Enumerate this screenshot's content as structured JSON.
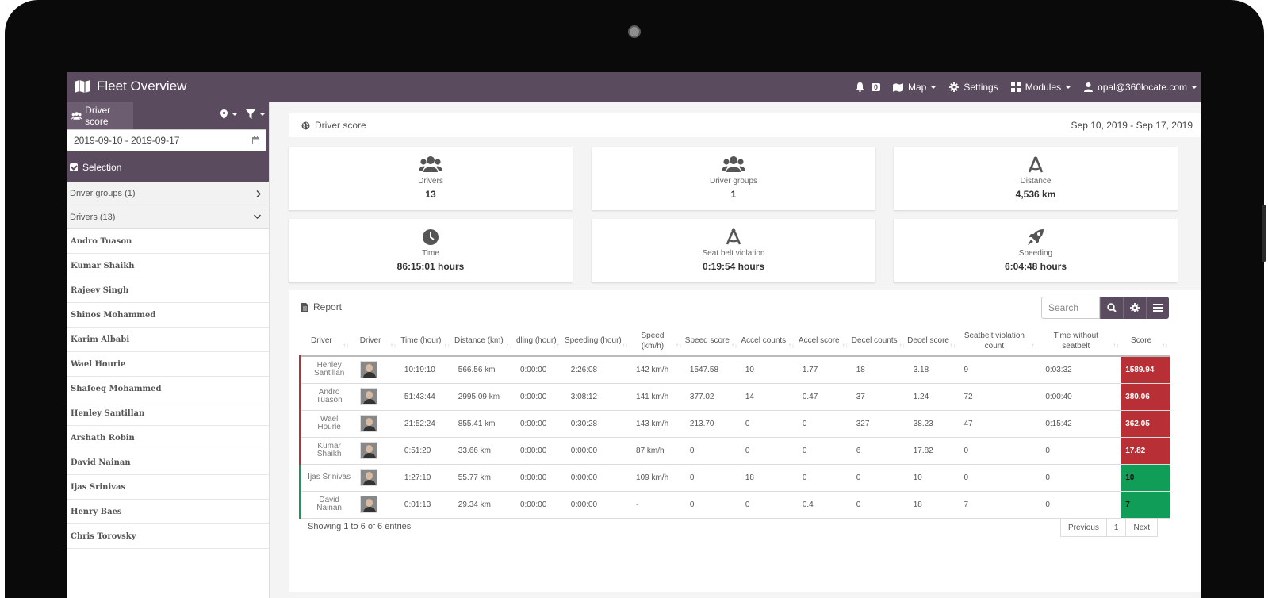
{
  "app": {
    "title": "Fleet Overview"
  },
  "nav": {
    "notifications": "0",
    "map": "Map",
    "settings": "Settings",
    "modules": "Modules",
    "user": "opal@360locate.com"
  },
  "sidebar": {
    "tab": "Driver score",
    "date_range": "2019-09-10 - 2019-09-17",
    "selection": "Selection",
    "groups": "Driver groups (1)",
    "drivers_header": "Drivers (13)",
    "drivers": [
      "Andro Tuason",
      "Kumar Shaikh",
      "Rajeev Singh",
      "Shinos Mohammed",
      "Karim Albabi",
      "Wael Hourie",
      "Shafeeq Mohammed",
      "Henley Santillan",
      "Arshath Robin",
      "David Nainan",
      "Ijas Srinivas",
      "Henry Baes",
      "Chris Torovsky"
    ]
  },
  "header": {
    "title": "Driver score",
    "range": "Sep 10, 2019 - Sep 17, 2019"
  },
  "cards": [
    {
      "label": "Drivers",
      "value": "13",
      "icon": "users-icon"
    },
    {
      "label": "Driver groups",
      "value": "1",
      "icon": "users-icon"
    },
    {
      "label": "Distance",
      "value": "4,536 km",
      "icon": "compass-icon"
    },
    {
      "label": "Time",
      "value": "86:15:01 hours",
      "icon": "clock-icon"
    },
    {
      "label": "Seat belt violation",
      "value": "0:19:54 hours",
      "icon": "compass-icon"
    },
    {
      "label": "Speeding",
      "value": "6:04:48 hours",
      "icon": "rocket-icon"
    }
  ],
  "report": {
    "title": "Report",
    "search_placeholder": "Search",
    "columns": [
      "Driver",
      "Driver",
      "Time (hour)",
      "Distance (km)",
      "Idling (hour)",
      "Speeding (hour)",
      "Speed (km/h)",
      "Speed score",
      "Accel counts",
      "Accel score",
      "Decel counts",
      "Decel score",
      "Seatbelt violation count",
      "Time without seatbelt",
      "Score"
    ],
    "rows": [
      {
        "name": "Henley Santillan",
        "time": "10:19:10",
        "distance": "566.56 km",
        "idling": "0:00:00",
        "speeding": "2:26:08",
        "speed": "142 km/h",
        "speed_score": "1547.58",
        "accel_counts": "10",
        "accel_score": "1.77",
        "decel_counts": "18",
        "decel_score": "3.18",
        "seatbelt_count": "9",
        "no_seatbelt": "0:03:32",
        "score": "1589.94",
        "status_color": "#b82f35"
      },
      {
        "name": "Andro Tuason",
        "time": "51:43:44",
        "distance": "2995.09 km",
        "idling": "0:00:00",
        "speeding": "3:08:12",
        "speed": "141 km/h",
        "speed_score": "377.02",
        "accel_counts": "14",
        "accel_score": "0.47",
        "decel_counts": "37",
        "decel_score": "1.24",
        "seatbelt_count": "72",
        "no_seatbelt": "0:00:40",
        "score": "380.06",
        "status_color": "#b82f35"
      },
      {
        "name": "Wael Hourie",
        "time": "21:52:24",
        "distance": "855.41 km",
        "idling": "0:00:00",
        "speeding": "0:30:28",
        "speed": "143 km/h",
        "speed_score": "213.70",
        "accel_counts": "0",
        "accel_score": "0",
        "decel_counts": "327",
        "decel_score": "38.23",
        "seatbelt_count": "47",
        "no_seatbelt": "0:15:42",
        "score": "362.05",
        "status_color": "#b82f35"
      },
      {
        "name": "Kumar Shaikh",
        "time": "0:51:20",
        "distance": "33.66 km",
        "idling": "0:00:00",
        "speeding": "0:00:00",
        "speed": "87 km/h",
        "speed_score": "0",
        "accel_counts": "0",
        "accel_score": "0",
        "decel_counts": "6",
        "decel_score": "17.82",
        "seatbelt_count": "0",
        "no_seatbelt": "0",
        "score": "17.82",
        "status_color": "#b82f35"
      },
      {
        "name": "Ijas Srinivas",
        "time": "1:27:10",
        "distance": "55.77 km",
        "idling": "0:00:00",
        "speeding": "0:00:00",
        "speed": "109 km/h",
        "speed_score": "0",
        "accel_counts": "18",
        "accel_score": "0",
        "decel_counts": "0",
        "decel_score": "10",
        "seatbelt_count": "0",
        "no_seatbelt": "0",
        "score": "10",
        "status_color": "#0f9d58"
      },
      {
        "name": "David Nainan",
        "time": "0:01:13",
        "distance": "29.34 km",
        "idling": "0:00:00",
        "speeding": "0:00:00",
        "speed": "-",
        "speed_score": "0",
        "accel_counts": "0",
        "accel_score": "0.4",
        "decel_counts": "0",
        "decel_score": "18",
        "seatbelt_count": "7",
        "no_seatbelt": "0",
        "score": "7",
        "status_color": "#0f9d58"
      }
    ],
    "info": "Showing 1 to 6 of 6 entries",
    "pager": {
      "prev": "Previous",
      "page": "1",
      "next": "Next"
    }
  },
  "colors": {
    "primary": "#5b4b5e",
    "danger": "#b82f35",
    "success": "#0f9d58"
  }
}
